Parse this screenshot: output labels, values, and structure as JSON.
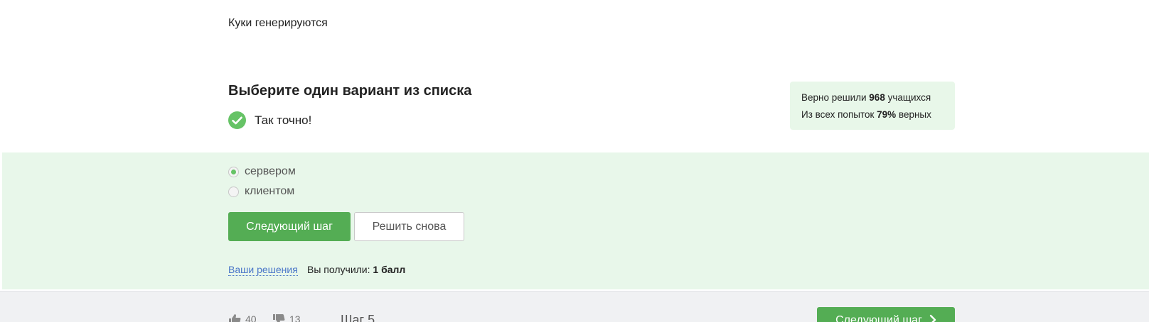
{
  "question": {
    "text": "Куки генерируются"
  },
  "task": {
    "title": "Выберите один вариант из списка",
    "feedback": "Так точно!"
  },
  "stats": {
    "solved_prefix": "Верно решили ",
    "solved_count": "968",
    "solved_suffix": " учащихся",
    "attempts_prefix": "Из всех попыток ",
    "attempts_percent": "79%",
    "attempts_suffix": " верных"
  },
  "options": [
    {
      "label": "сервером",
      "selected": true
    },
    {
      "label": "клиентом",
      "selected": false
    }
  ],
  "buttons": {
    "next_step": "Следующий шаг",
    "retry": "Решить снова"
  },
  "result": {
    "solutions_link": "Ваши решения",
    "score_prefix": "Вы получили: ",
    "score_value": "1 балл"
  },
  "footer": {
    "likes": "40",
    "dislikes": "13",
    "step": "Шаг 5",
    "next_step": "Следующий шаг"
  },
  "colors": {
    "accent_green": "#54ad54",
    "check_green": "#66c366",
    "panel_bg": "#e8f7ea",
    "link_blue": "#4a76c8"
  }
}
